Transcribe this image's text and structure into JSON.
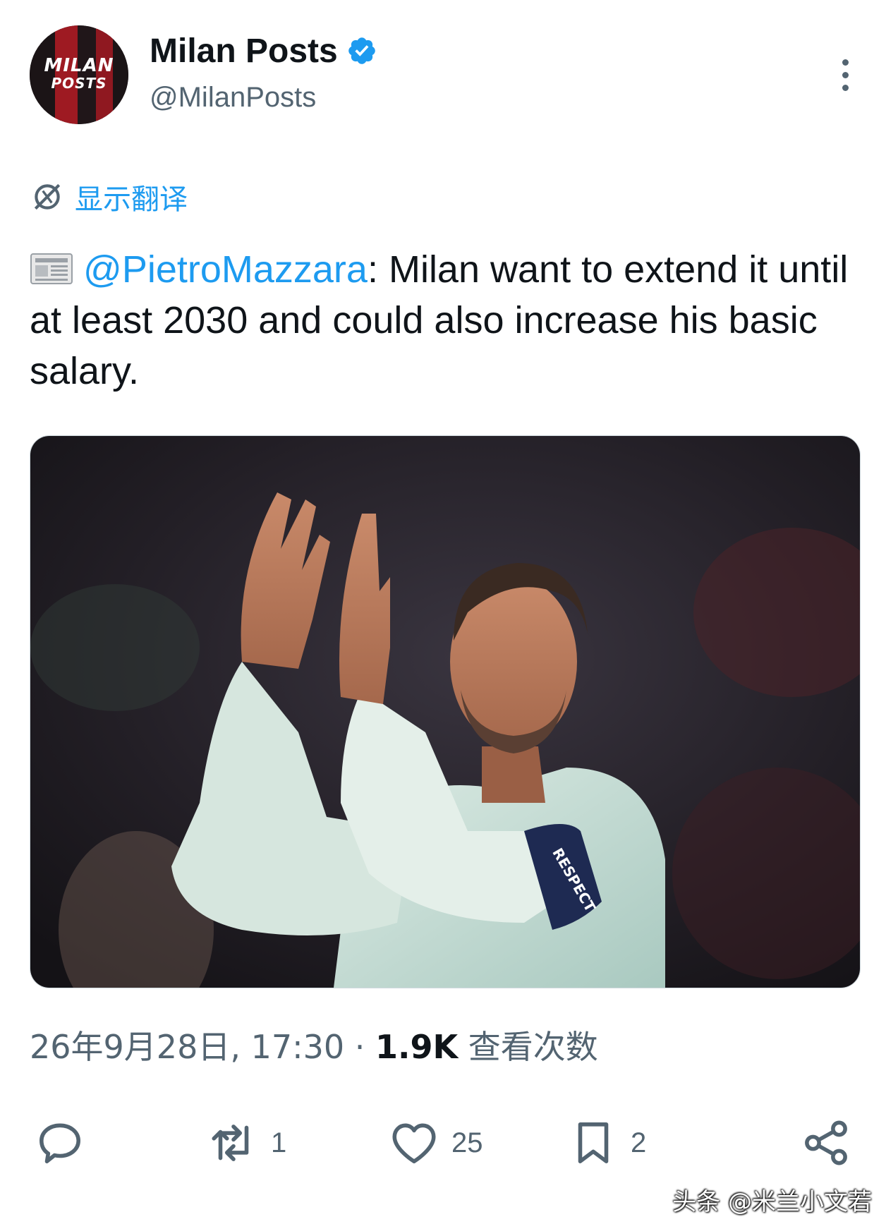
{
  "account": {
    "display_name": "Milan Posts",
    "handle": "@MilanPosts",
    "avatar_text_line1": "MILAN",
    "avatar_text_line2": "POSTS",
    "verified": true
  },
  "translate": {
    "label": "显示翻译"
  },
  "tweet": {
    "emoji": "newspaper",
    "mention": "@PietroMazzara",
    "text": ": Milan want to extend it until at least 2030 and could also increase his basic salary."
  },
  "media": {
    "armband_text": "RESPECT"
  },
  "meta": {
    "timestamp": "26年9月28日, 17:30",
    "separator": " · ",
    "views_count": "1.9K",
    "views_label": " 查看次数"
  },
  "actions": {
    "retweets": "1",
    "likes": "25",
    "bookmarks": "2"
  },
  "watermark": "头条 @米兰小文若",
  "colors": {
    "accent": "#1d9bf0",
    "text_primary": "#0f1419",
    "text_secondary": "#536471",
    "milan_red": "#b11c24"
  }
}
